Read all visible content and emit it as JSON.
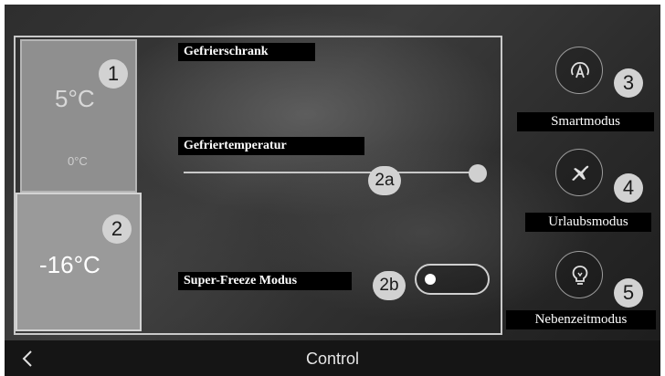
{
  "zones": {
    "fridge": {
      "current_temp": "5°C",
      "set_temp": "0°C",
      "badge": "1"
    },
    "freezer": {
      "current_temp": "-16°C",
      "badge": "2"
    }
  },
  "panel": {
    "title": "Gefrierschrank",
    "temperature_label": "Gefriertemperatur",
    "slider_badge": "2a",
    "slider_level": 1.0,
    "superfreeze_label": "Super-Freeze Modus",
    "superfreeze_badge": "2b",
    "superfreeze_on": false
  },
  "modes": [
    {
      "label": "Smartmodus",
      "badge": "3",
      "icon": "smart-mode-icon"
    },
    {
      "label": "Urlaubsmodus",
      "badge": "4",
      "icon": "airplane-icon"
    },
    {
      "label": "Nebenzeitmodus",
      "badge": "5",
      "icon": "lightbulb-icon"
    }
  ],
  "bottom_bar": {
    "title": "Control",
    "back_icon": "chevron-left-icon"
  }
}
